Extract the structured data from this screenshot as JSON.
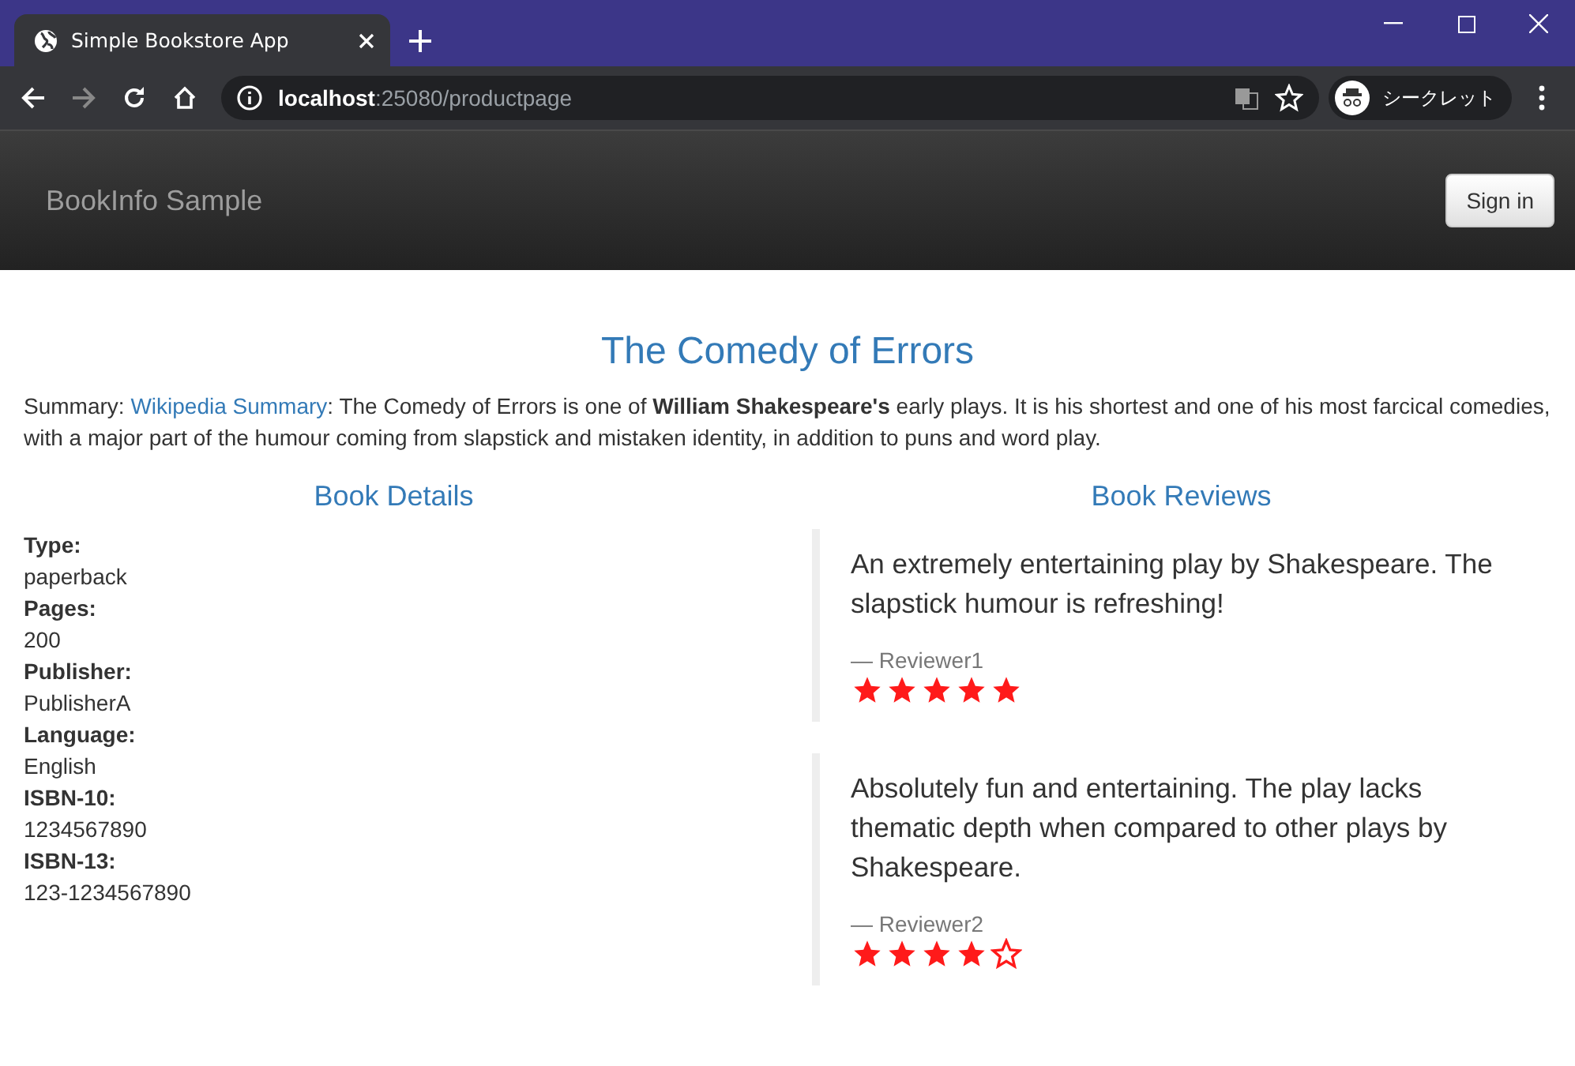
{
  "browser": {
    "tab": {
      "title": "Simple Bookstore App",
      "selected": true
    },
    "url_host": "localhost",
    "url_rest": ":25080/productpage",
    "incognito": "シークレット"
  },
  "navbar": {
    "brand": "BookInfo Sample",
    "sign_in": "Sign in"
  },
  "title": "The Comedy of Errors",
  "summary": {
    "label": "Summary: ",
    "link": "Wikipedia Summary",
    "text": ": The Comedy of Errors is one of **William Shakespeare's** early plays. It is his shortest and one of his most farcical comedies, with a major part of the humour coming from slapstick and mistaken identity, in addition to puns and word play."
  },
  "details": {
    "heading": "Book Details",
    "items": [
      {
        "label": "Type:",
        "value": "paperback"
      },
      {
        "label": "Pages:",
        "value": "200"
      },
      {
        "label": "Publisher:",
        "value": "PublisherA"
      },
      {
        "label": "Language:",
        "value": "English"
      },
      {
        "label": "ISBN-10:",
        "value": "1234567890"
      },
      {
        "label": "ISBN-13:",
        "value": "123-1234567890"
      }
    ]
  },
  "reviews": {
    "heading": "Book Reviews",
    "items": [
      {
        "text": "An extremely entertaining play by Shakespeare. The slapstick humour is refreshing!",
        "reviewer": "— Reviewer1",
        "stars": 5
      },
      {
        "text": "Absolutely fun and entertaining. The play lacks thematic depth when compared to other plays by Shakespeare.",
        "reviewer": "— Reviewer2",
        "stars": 4
      }
    ]
  }
}
